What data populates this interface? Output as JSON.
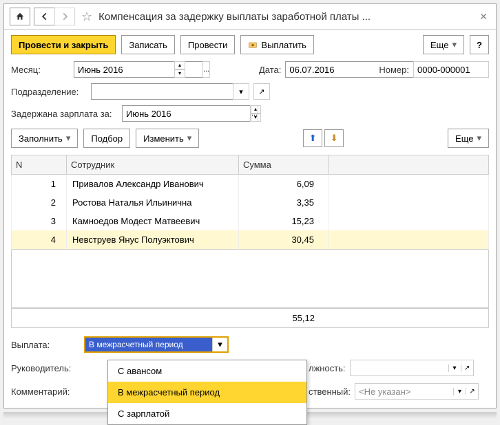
{
  "header": {
    "title": "Компенсация за задержку выплаты заработной платы ..."
  },
  "toolbar": {
    "post_close": "Провести и закрыть",
    "save": "Записать",
    "post": "Провести",
    "pay": "Выплатить",
    "more": "Еще",
    "help": "?"
  },
  "fields": {
    "month_label": "Месяц:",
    "month_value": "Июнь 2016",
    "date_label": "Дата:",
    "date_value": "06.07.2016",
    "number_label": "Номер:",
    "number_value": "0000-000001",
    "division_label": "Подразделение:",
    "division_value": "",
    "delayed_label": "Задержана зарплата за:",
    "delayed_value": "Июнь 2016"
  },
  "table_toolbar": {
    "fill": "Заполнить",
    "select": "Подбор",
    "edit": "Изменить",
    "more": "Еще"
  },
  "table": {
    "headers": {
      "n": "N",
      "employee": "Сотрудник",
      "sum": "Сумма"
    },
    "rows": [
      {
        "n": "1",
        "emp": "Привалов Александр Иванович",
        "sum": "6,09"
      },
      {
        "n": "2",
        "emp": "Ростова Наталья Ильинична",
        "sum": "3,35"
      },
      {
        "n": "3",
        "emp": "Камноедов Модест Матвеевич",
        "sum": "15,23"
      },
      {
        "n": "4",
        "emp": "Невструев Янус Полуэктович",
        "sum": "30,45"
      }
    ],
    "total": "55,12"
  },
  "payment": {
    "label": "Выплата:",
    "selected": "В межрасчетный период",
    "options": [
      "С авансом",
      "В межрасчетный период",
      "С зарплатой"
    ]
  },
  "signers": {
    "head_label": "Руководитель:",
    "position_label": "лжность:",
    "responsible_label": "ственный:",
    "responsible_value": "<Не указан>",
    "comment_label": "Комментарий:"
  }
}
